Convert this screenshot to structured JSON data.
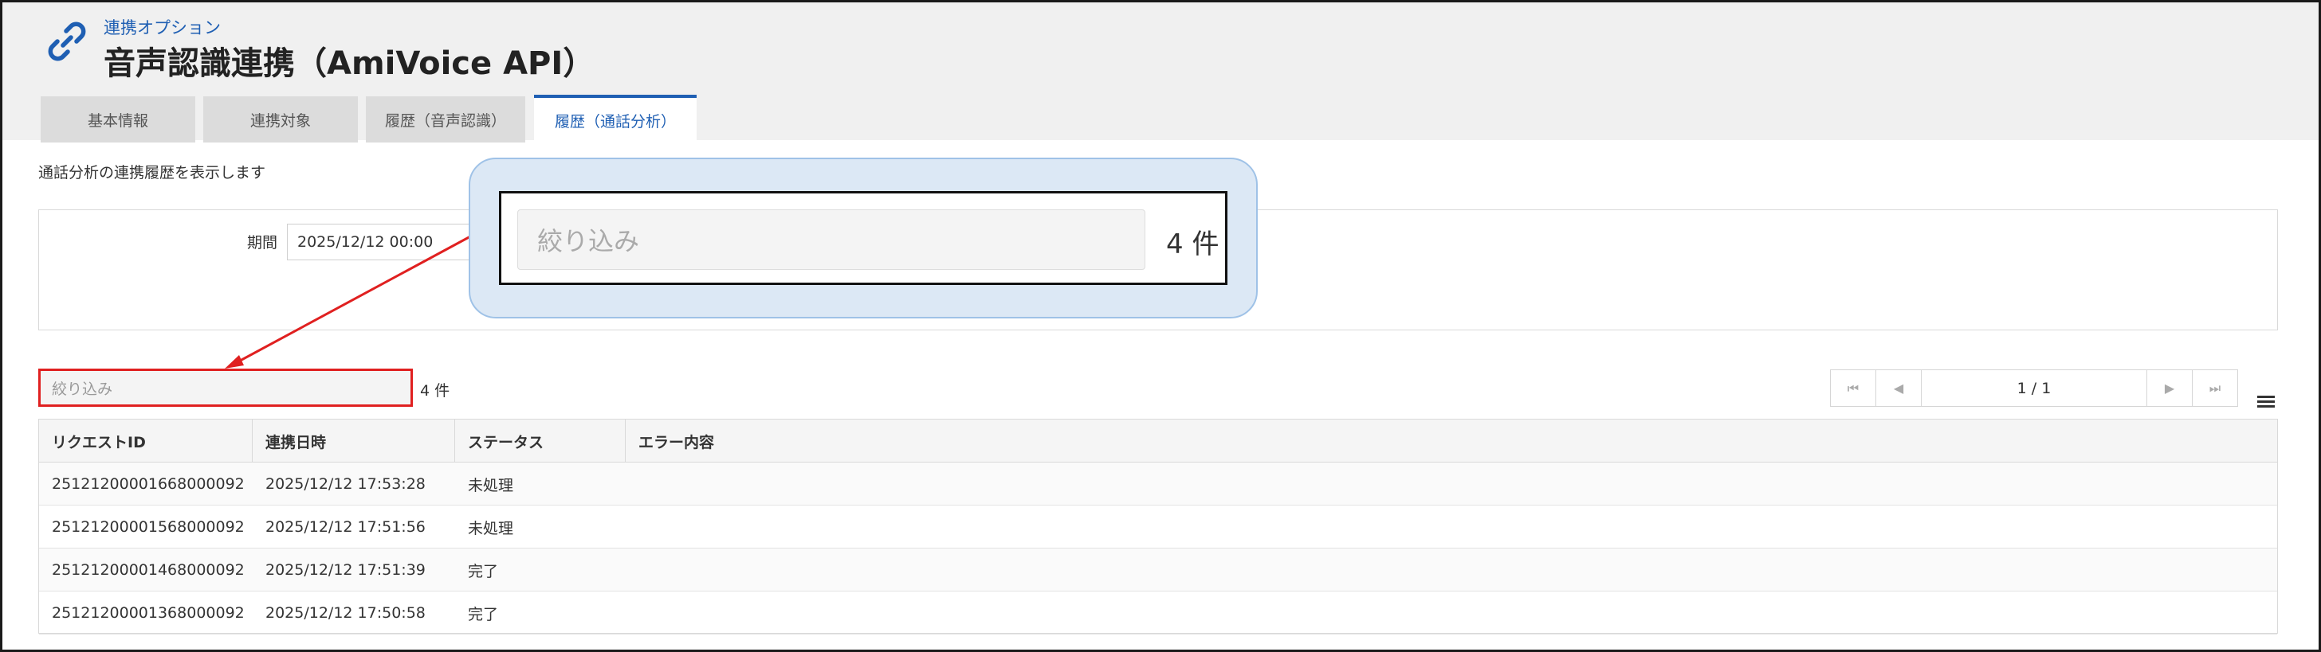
{
  "header": {
    "subtitle": "連携オプション",
    "title": "音声認識連携（AmiVoice API）",
    "icon": "link-icon",
    "accent_color": "#1f5fb3"
  },
  "tabs": [
    {
      "label": "基本情報",
      "active": false
    },
    {
      "label": "連携対象",
      "active": false
    },
    {
      "label": "履歴（音声認識）",
      "active": false
    },
    {
      "label": "履歴（通話分析）",
      "active": true
    }
  ],
  "description": "通話分析の連携履歴を表示します",
  "filter": {
    "period_label": "期間",
    "period_start": "2025/12/12 00:00"
  },
  "search": {
    "placeholder": "絞り込み",
    "count": "4 件"
  },
  "pagination": {
    "page_info": "1 / 1"
  },
  "table": {
    "columns": [
      "リクエストID",
      "連携日時",
      "ステータス",
      "エラー内容"
    ],
    "rows": [
      {
        "request_id": "25121200001668000092",
        "datetime": "2025/12/12 17:53:28",
        "status": "未処理",
        "error": ""
      },
      {
        "request_id": "25121200001568000092",
        "datetime": "2025/12/12 17:51:56",
        "status": "未処理",
        "error": ""
      },
      {
        "request_id": "25121200001468000092",
        "datetime": "2025/12/12 17:51:39",
        "status": "完了",
        "error": ""
      },
      {
        "request_id": "25121200001368000092",
        "datetime": "2025/12/12 17:50:58",
        "status": "完了",
        "error": ""
      }
    ]
  },
  "callout": {
    "placeholder": "絞り込み",
    "count": "4 件",
    "highlight_color": "#e02020"
  }
}
